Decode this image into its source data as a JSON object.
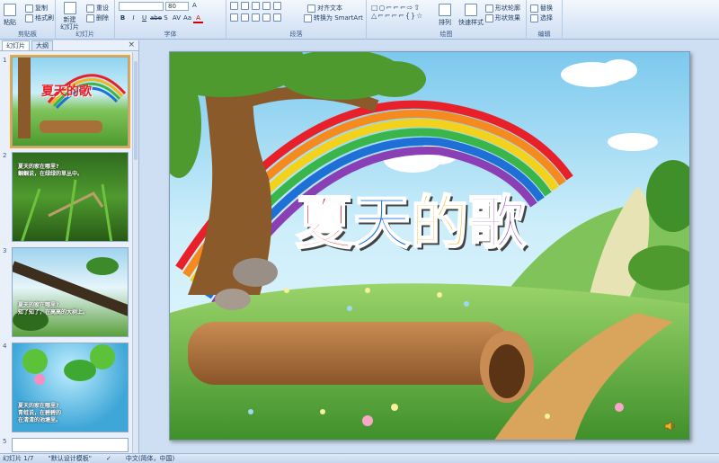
{
  "ribbon": {
    "clipboard": {
      "label": "剪贴板",
      "paste": "粘贴",
      "copy": "复制",
      "format_painter": "格式刷"
    },
    "slides": {
      "label": "幻灯片",
      "new_slide": "新建\n幻灯片",
      "reset": "重设",
      "delete": "删除"
    },
    "font": {
      "label": "字体",
      "size_value": "80",
      "bold": "B",
      "italic": "I",
      "underline": "U",
      "strike": "abe",
      "shadow": "S",
      "spacing": "AV",
      "case": "Aa",
      "color": "A"
    },
    "paragraph": {
      "label": "段落",
      "align_text": "对齐文本",
      "convert_smartart": "转换为 SmartArt"
    },
    "drawing": {
      "label": "绘图",
      "arrange": "排列",
      "quick_styles": "快速样式",
      "shape_outline": "形状轮廓",
      "shape_effects": "形状效果"
    },
    "editing": {
      "label": "编辑",
      "replace": "替换",
      "select": "选择"
    }
  },
  "pane": {
    "tabs": [
      "幻灯片",
      "大纲"
    ],
    "slides": [
      {
        "num": "1",
        "title": "夏天的歌"
      },
      {
        "num": "2",
        "text": "夏天的家在哪里?\n蝈蝈说，在绿绿的草丛中。"
      },
      {
        "num": "3",
        "text": "夏天的家在哪里?\n知了知了，在高高的大树上。"
      },
      {
        "num": "4",
        "text": "夏天的家在哪里?\n青蛙说，在碧碧的\n在清清的池塘里。"
      },
      {
        "num": "5"
      }
    ]
  },
  "slide": {
    "title_chars": [
      {
        "char": "夏",
        "color": "#e8202a"
      },
      {
        "char": "天",
        "color": "#1e6fd6"
      },
      {
        "char": "的",
        "color": "#f3b51b"
      },
      {
        "char": "歌",
        "color": "#8a3fb5"
      }
    ]
  },
  "status": {
    "slide_info": "幻灯片 1/7",
    "theme": "\"默认设计模板\"",
    "language": "中文(简体，中国)"
  }
}
